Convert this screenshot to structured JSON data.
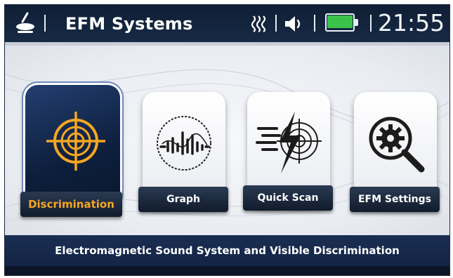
{
  "header": {
    "title": "EFM Systems",
    "time": "21:55",
    "battery_level": 1.0,
    "icons": [
      "metal-detector-icon",
      "signal-icon",
      "volume-icon",
      "battery-icon"
    ]
  },
  "menu": {
    "items": [
      {
        "label": "Discrimination",
        "icon": "crosshair-target-icon",
        "selected": true
      },
      {
        "label": "Graph",
        "icon": "waveform-icon",
        "selected": false
      },
      {
        "label": "Quick Scan",
        "icon": "lightning-radar-icon",
        "selected": false
      },
      {
        "label": "EFM  Settings",
        "icon": "gear-magnifier-icon",
        "selected": false
      }
    ]
  },
  "footer": {
    "text": "Electromagnetic Sound System and Visible Discrimination"
  },
  "colors": {
    "header_bg": "#0f1e34",
    "accent_orange": "#f5a623",
    "battery_green": "#3bc24a",
    "footer_bg": "#1a2e52"
  }
}
